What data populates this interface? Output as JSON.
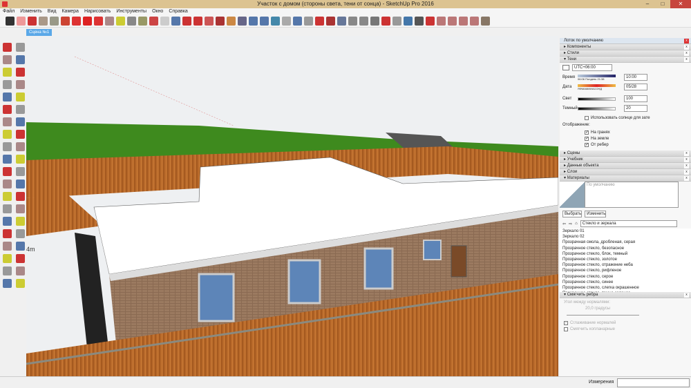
{
  "window": {
    "title": "Участок с домом (стороны света, тени от сонца) - SketchUp Pro 2016",
    "minimize": "–",
    "maximize": "□",
    "close": "✕"
  },
  "menu": [
    "Файл",
    "Изменить",
    "Вид",
    "Камера",
    "Нарисовать",
    "Инструменты",
    "Окно",
    "Справка"
  ],
  "toolbar_icons": [
    [
      "select-icon",
      "#333"
    ],
    [
      "eraser-icon",
      "#e99"
    ],
    [
      "pencil-icon",
      "#c33"
    ],
    [
      "arc-icon",
      "#a98"
    ],
    [
      "rectangle-icon",
      "#998"
    ],
    [
      "push-pull-icon",
      "#c43"
    ],
    [
      "follow-me-icon",
      "#d33"
    ],
    [
      "move-icon",
      "#d22"
    ],
    [
      "rotate-icon",
      "#d33"
    ],
    [
      "scale-icon",
      "#a88"
    ],
    [
      "tape-measure-icon",
      "#cc3"
    ],
    [
      "text-icon",
      "#888"
    ],
    [
      "paint-bucket-icon",
      "#996"
    ],
    [
      "orbit-icon",
      "#c44"
    ],
    [
      "pan-icon",
      "#ccc"
    ],
    [
      "zoom-icon",
      "#57a"
    ],
    [
      "zoom-extents-icon",
      "#c33"
    ],
    [
      "components-icon",
      "#c33"
    ],
    [
      "3d-warehouse-icon",
      "#c55"
    ],
    [
      "extension-icon",
      "#a33"
    ],
    [
      "section-plane-icon",
      "#c84"
    ],
    [
      "position-camera-icon",
      "#668"
    ],
    [
      "walk-icon",
      "#57a"
    ],
    [
      "look-around-icon",
      "#57a"
    ],
    [
      "x-ray-icon",
      "#48a"
    ],
    [
      "back-edges-icon",
      "#aaa"
    ],
    [
      "wireframe-icon",
      "#57a"
    ],
    [
      "hidden-line-icon",
      "#999"
    ],
    [
      "shaded-icon",
      "#c33"
    ],
    [
      "textured-icon",
      "#a33"
    ],
    [
      "save-icon",
      "#679"
    ],
    [
      "cut-icon",
      "#888"
    ],
    [
      "copy-icon",
      "#888"
    ],
    [
      "paste-icon",
      "#777"
    ],
    [
      "delete-icon",
      "#c33"
    ],
    [
      "undo-icon",
      "#999"
    ],
    [
      "redo-icon",
      "#47a"
    ],
    [
      "print-icon",
      "#555"
    ],
    [
      "model-info-icon",
      "#c33"
    ],
    [
      "top-view-icon",
      "#b77"
    ],
    [
      "front-view-icon",
      "#b77"
    ],
    [
      "right-view-icon",
      "#b77"
    ],
    [
      "back-view-icon",
      "#b77"
    ],
    [
      "left-view-icon",
      "#876"
    ]
  ],
  "left_icons": [
    "select-icon",
    "component-icon",
    "paint-bucket-icon",
    "eraser-icon",
    "line-icon",
    "freehand-icon",
    "rectangle-icon",
    "rotated-rectangle-icon",
    "circle-icon",
    "polygon-icon",
    "arc-icon",
    "pie-icon",
    "arc-2point-icon",
    "arc-3point-icon",
    "move-icon",
    "push-pull-icon",
    "rotate-icon",
    "follow-me-icon",
    "scale-icon",
    "offset-icon",
    "tape-measure-icon",
    "text-icon",
    "axes-icon",
    "3d-text-icon",
    "orbit-icon",
    "pan-icon",
    "zoom-icon",
    "zoom-window-icon",
    "zoom-extents-icon",
    "previous-view-icon",
    "position-camera-icon",
    "look-around-icon",
    "walk-icon",
    "section-plane-icon",
    "components-icon",
    "warehouse-icon",
    "home-icon",
    "house-icon",
    "house-outline-icon",
    "house-share-icon"
  ],
  "scene_tab": "Сцена №1",
  "viewport": {
    "dimension_label": "4m"
  },
  "panel": {
    "title": "Лоток по умолчанию",
    "sections_top": [
      "Компоненты",
      "Стили"
    ],
    "shadows": {
      "header": "Тени",
      "timezone": "UTC+06:00",
      "time_label": "Время",
      "time_start": "06:06",
      "time_mid": "Полдень",
      "time_end": "21:38",
      "time_value": "10:00",
      "date_label": "Дата",
      "months": "ЯФМАМИИАСОНД",
      "date_value": "05/28",
      "light_label": "Свет",
      "light_value": "100",
      "dark_label": "Темный",
      "dark_value": "20",
      "use_sun": "Использовать солнце для зате",
      "display_label": "Отображение:",
      "on_faces": "На гранях",
      "on_ground": "На земле",
      "from_edges": "От ребер"
    },
    "sections_mid": [
      "Сцены",
      "Учебник",
      "Данные объекта",
      "Слои"
    ],
    "materials": {
      "header": "Материалы",
      "name": "По умолчанию",
      "tab_select": "Выбрать",
      "tab_edit": "Изменить",
      "collection": "Стекло и зеркала",
      "items": [
        "Зеркало 01",
        "Зеркало 02",
        "Прозрачная смола, дробленая, серая",
        "Прозрачное стекло, безопасное",
        "Прозрачное стекло, блок, темный",
        "Прозрачное стекло, золотое",
        "Прозрачное стекло, отражение неба",
        "Прозрачное стекло, рифленое",
        "Прозрачное стекло, серое",
        "Прозрачное стекло, синее",
        "Прозрачное стекло, слегка окрашенное",
        "Прозрачное стекло, темно-зеленое"
      ]
    },
    "soften": {
      "header": "Смягчить ребра",
      "angle_label": "Угол между нормалями:",
      "angle_value": "20,0  градусы",
      "smooth_normals": "Сглаживание нормалей",
      "soften_coplanar": "Смягчить копланарные"
    }
  },
  "status": {
    "measurements_label": "Измерения",
    "measurements_value": ""
  }
}
